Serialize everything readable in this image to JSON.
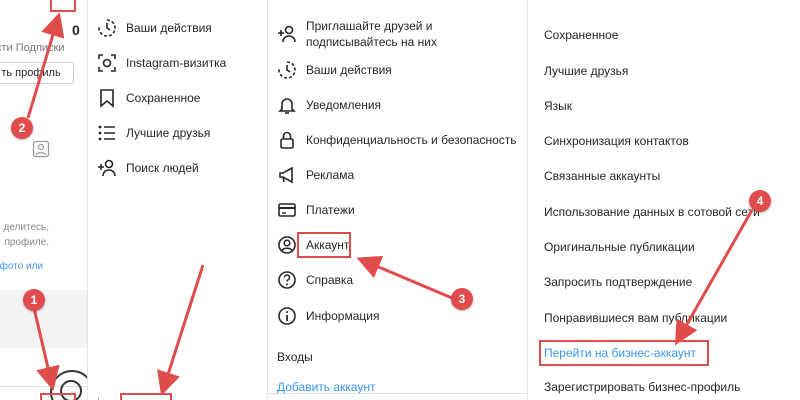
{
  "accent_color": "#e04b4b",
  "link_color": "#3897f0",
  "profile_panel": {
    "posts_count": "0",
    "stats_text": "сти   Подписки",
    "edit_button": "ть профиль",
    "text_line_1": "делитесь,",
    "text_line_2": "профиле.",
    "link_text": "фото или"
  },
  "menu_panel": {
    "items": [
      {
        "label": "Ваши действия",
        "icon": "activity-icon"
      },
      {
        "label": "Instagram-визитка",
        "icon": "nametag-icon"
      },
      {
        "label": "Сохраненное",
        "icon": "bookmark-icon"
      },
      {
        "label": "Лучшие друзья",
        "icon": "close-friends-icon"
      },
      {
        "label": "Поиск людей",
        "icon": "add-person-icon"
      }
    ]
  },
  "settings_panel": {
    "items": [
      {
        "label_line1": "Приглашайте друзей и",
        "label_line2": "подписывайтесь на них",
        "icon": "add-person-icon"
      },
      {
        "label": "Ваши действия",
        "icon": "activity-icon"
      },
      {
        "label": "Уведомления",
        "icon": "bell-icon"
      },
      {
        "label": "Конфиденциальность и безопасность",
        "icon": "lock-icon"
      },
      {
        "label": "Реклама",
        "icon": "megaphone-icon"
      },
      {
        "label": "Платежи",
        "icon": "card-icon"
      },
      {
        "label": "Аккаунт",
        "icon": "account-icon"
      },
      {
        "label": "Справка",
        "icon": "help-icon"
      },
      {
        "label": "Информация",
        "icon": "info-icon"
      }
    ],
    "section_logins": "Входы",
    "add_account": "Добавить аккаунт"
  },
  "account_panel": {
    "items": [
      "Сохраненное",
      "Лучшие друзья",
      "Язык",
      "Синхронизация контактов",
      "Связанные аккаунты",
      "Использование данных в сотовой сети",
      "Оригинальные публикации",
      "Запросить подтверждение",
      "Понравившиеся вам публикации",
      "Перейти на бизнес-аккаунт",
      "Зарегистрировать бизнес-профиль"
    ]
  },
  "annotations": {
    "step1": "1",
    "step2": "2",
    "step3": "3",
    "step4": "4"
  }
}
